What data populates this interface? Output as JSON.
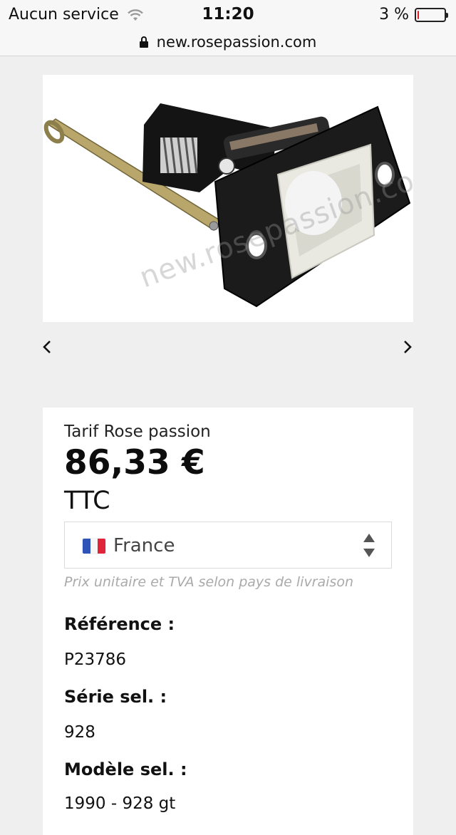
{
  "status_bar": {
    "carrier": "Aucun service",
    "time": "11:20",
    "battery": "3 %",
    "battery_level": 0.03
  },
  "browser": {
    "url": "new.rosepassion.com"
  },
  "product": {
    "watermark": "new.rosepassion.com",
    "image_icon": "door-latch-mechanism"
  },
  "pricing": {
    "label": "Tarif Rose passion",
    "price": "86,33 €",
    "tax": "TTC",
    "country": "France",
    "note": "Prix unitaire et TVA selon pays de livraison"
  },
  "details": {
    "reference_label": "Référence :",
    "reference_value": "P23786",
    "series_label": "Série sel. :",
    "series_value": "928",
    "model_label": "Modèle sel. :",
    "model_value": "1990 - 928 gt"
  },
  "colors": {
    "background": "#efefef",
    "battery_low": "#e02020",
    "flag_blue": "#2e54b8",
    "flag_red": "#e0243a"
  }
}
